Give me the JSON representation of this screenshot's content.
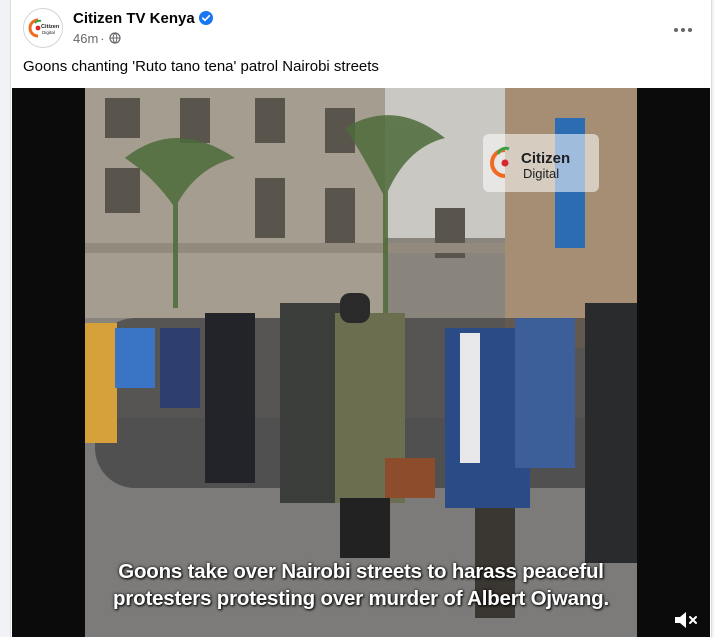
{
  "post": {
    "page_name": "Citizen TV Kenya",
    "verified": true,
    "time": "46m",
    "visibility_icon": "globe-icon",
    "more_icon": "more-options-icon",
    "caption": "Goons chanting 'Ruto tano tena' patrol Nairobi streets"
  },
  "avatar": {
    "brand_text": "Citizen",
    "brand_sub": "Digital"
  },
  "video": {
    "watermark_title": "Citizen",
    "watermark_sub": "Digital",
    "subtitle_line1": "Goons take over Nairobi streets to harass peaceful",
    "subtitle_line2": "protesters protesting over  murder of Albert Ojwang.",
    "mute_icon": "volume-muted-icon"
  },
  "colors": {
    "verified_blue": "#1877f2",
    "brand_orange": "#f26a21",
    "brand_green": "#3aa046",
    "brand_red": "#d7262e"
  }
}
